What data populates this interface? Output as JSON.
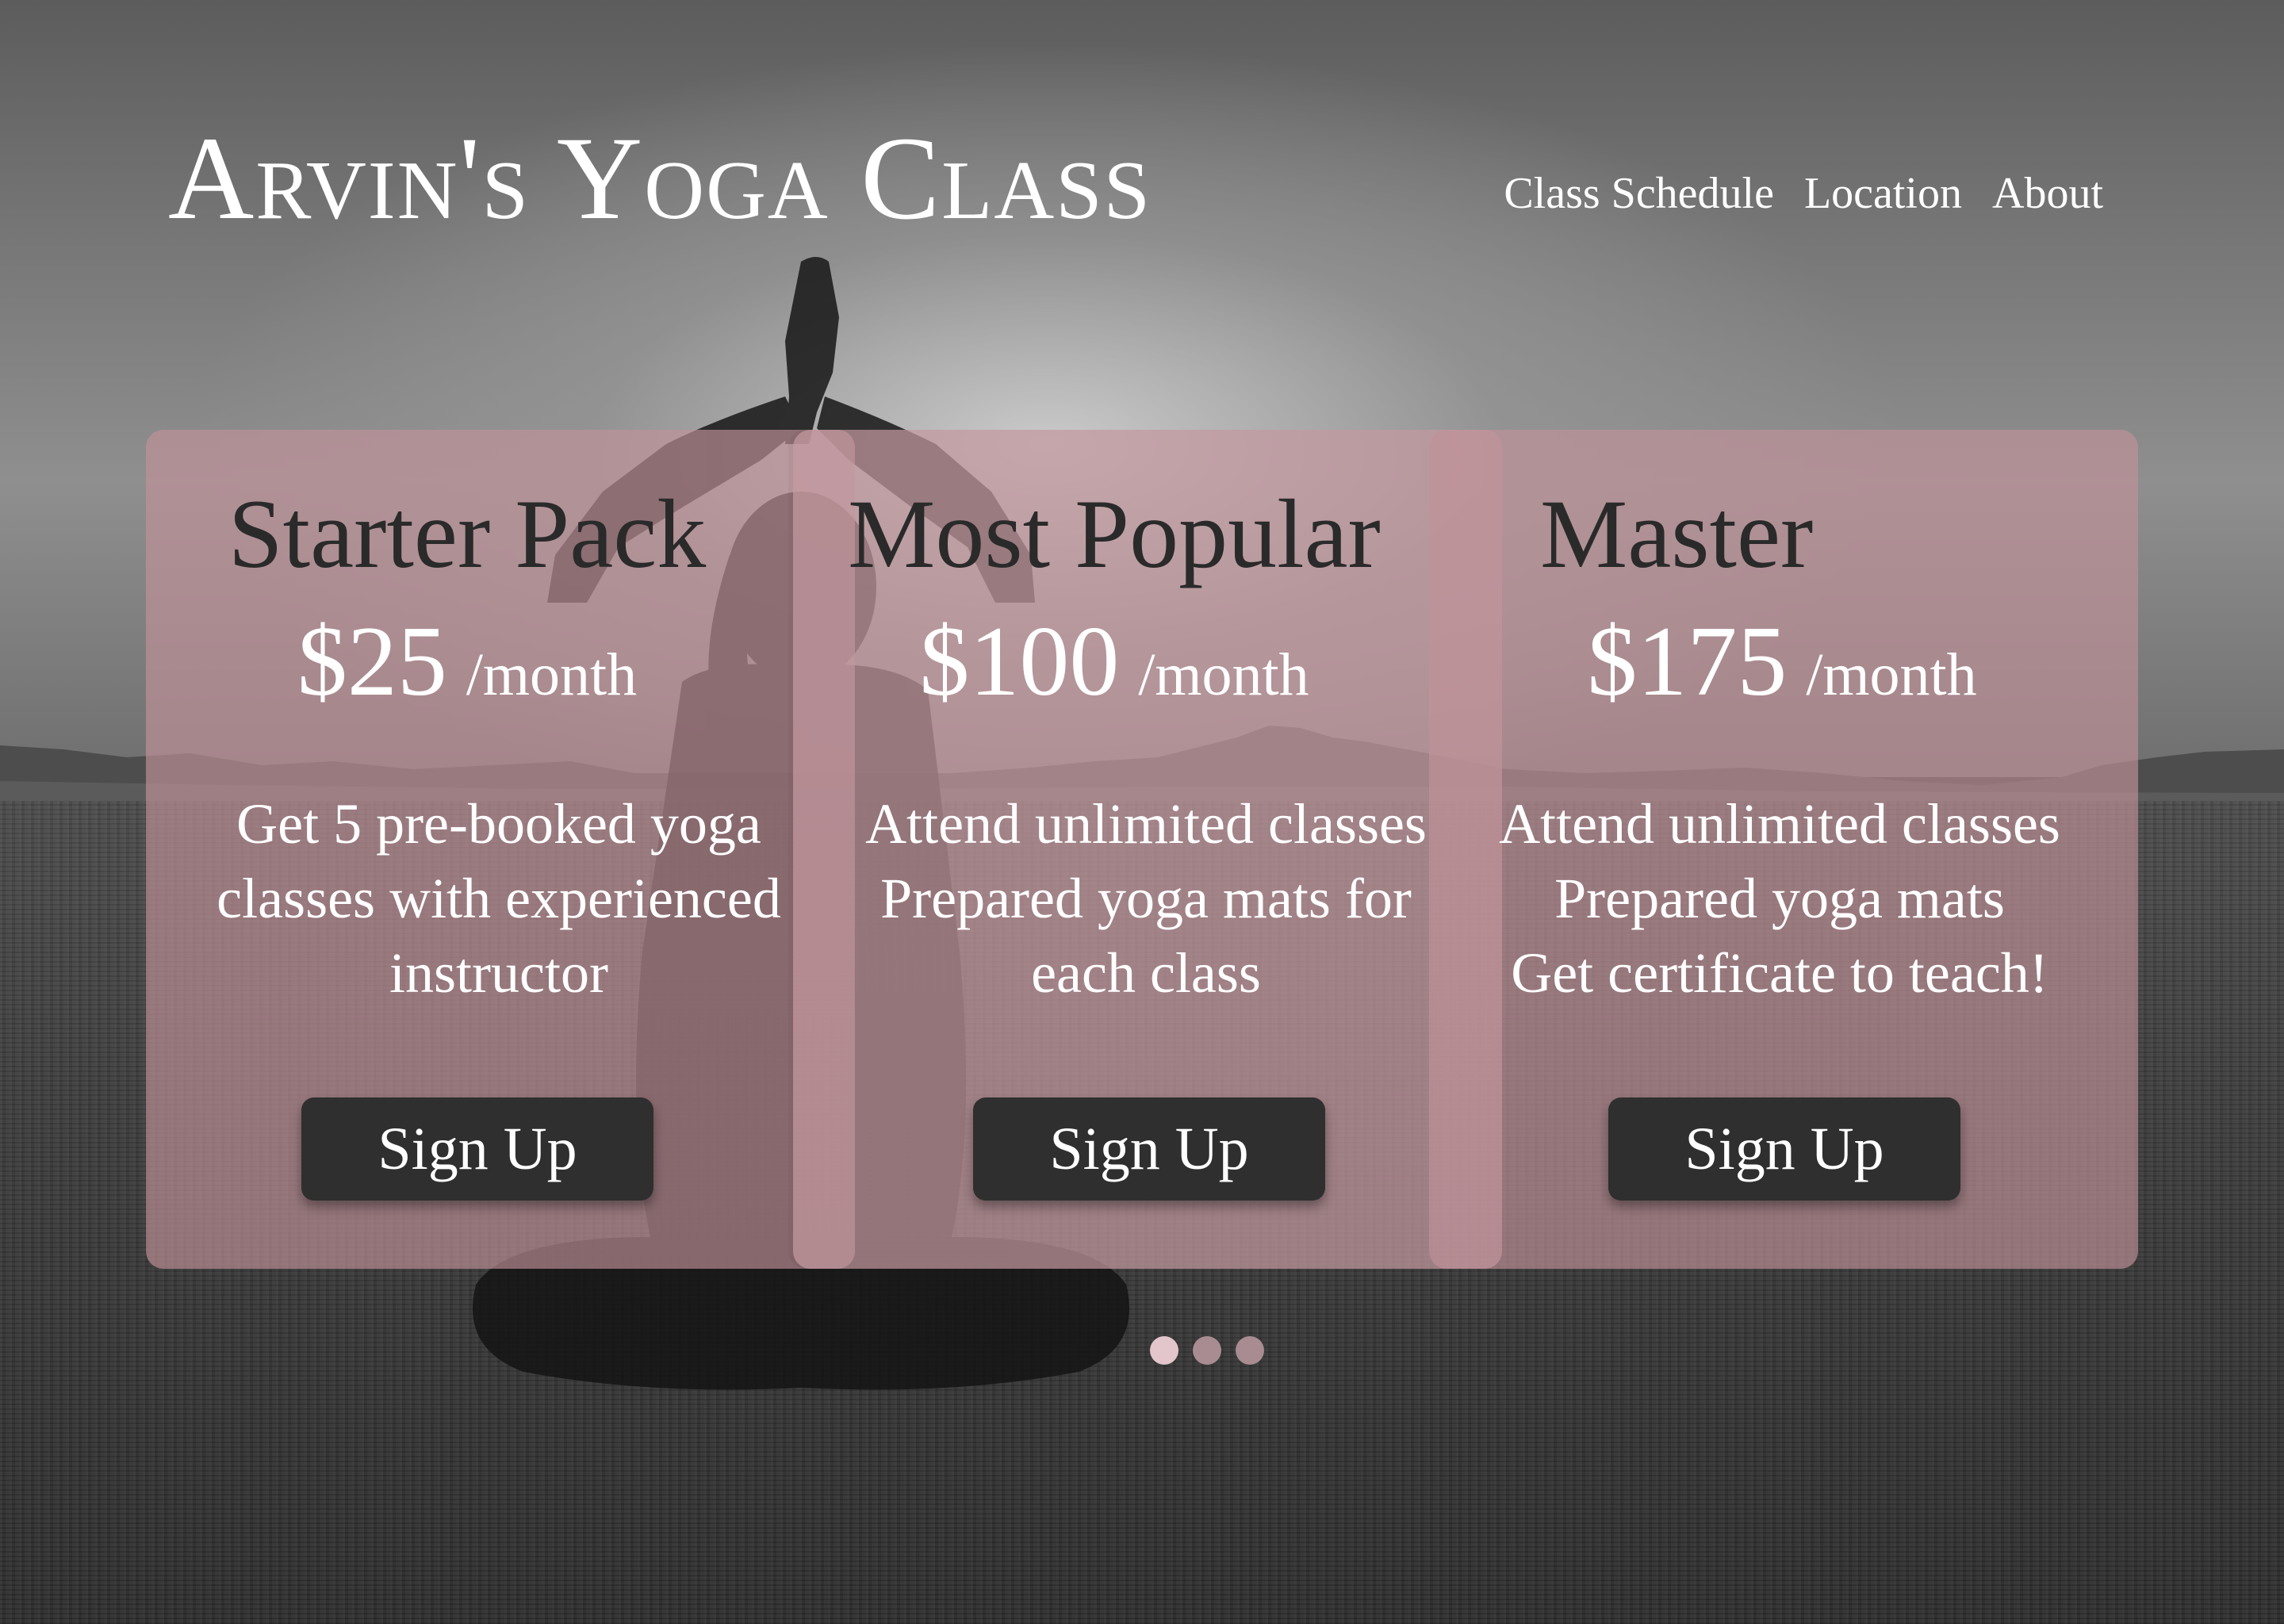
{
  "header": {
    "title": "Arvin's Yoga Class",
    "nav": [
      "Class Schedule",
      "Location",
      "About"
    ]
  },
  "plans": [
    {
      "name": "Starter Pack",
      "price": "$25",
      "period": "/month",
      "features": [
        "Get 5 pre-booked yoga",
        "classes with experienced",
        "instructor"
      ],
      "cta": "Sign Up"
    },
    {
      "name": "Most Popular",
      "price": "$100",
      "period": "/month",
      "features": [
        "Attend unlimited classes",
        "Prepared yoga mats for",
        "each class"
      ],
      "cta": "Sign Up"
    },
    {
      "name": "Master",
      "price": "$175",
      "period": "/month",
      "features": [
        "Attend unlimited classes",
        "Prepared yoga mats",
        "Get certificate to teach!"
      ],
      "cta": "Sign Up"
    }
  ],
  "carousel": {
    "total_slides": 3,
    "active_slide": 1
  },
  "colors": {
    "card_tint": "#c1929a",
    "button_bg": "#2f2f2f",
    "title_text": "#2a2a2a",
    "dot_active": "#e3c6cb",
    "dot_inactive": "#a88c91"
  },
  "background": {
    "icon": "meditating-person-silhouette-icon"
  }
}
